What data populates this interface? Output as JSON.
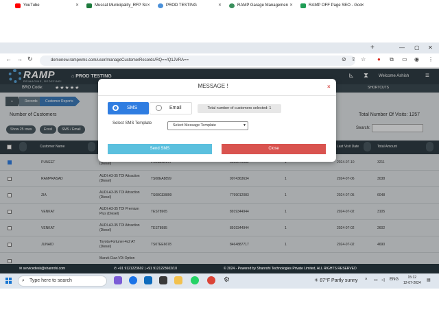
{
  "browser": {
    "tabs": [
      {
        "label": "YouTube",
        "color": "#ff0000"
      },
      {
        "label": "Muscat Municipality_RFP Sc",
        "color": "#1d7a3c"
      },
      {
        "label": "PROD TESTING",
        "color": "#4a90d9"
      },
      {
        "label": "RAMP Garage Managemen",
        "color": "#3a8f5c"
      },
      {
        "label": "RAMP OFF Page SEO - Goo",
        "color": "#1f9d55"
      }
    ],
    "url": "demonew.rampwms.com/user/manageCustomerRecords/RQ==/Q1JVRA=="
  },
  "app": {
    "logo": "RAMP",
    "logo_tagline": "REIMAGINE, REDEFINE!",
    "env_label": "PROD TESTING",
    "welcome": "Welcome  Ashish",
    "bro_code_label": "BRO Code:",
    "bro_stars": "★★★★★",
    "shortcuts_label": "SHORTCUTS"
  },
  "page": {
    "breadcrumbs": [
      "Records",
      "Customer Reports"
    ],
    "section_title": "Number of Customers",
    "total_visits": "Total Number Of Visits: 1257",
    "toolbar_buttons": [
      "Show 25 rows",
      "Excel",
      "SMS / Email"
    ],
    "search_label": "Search:",
    "columns": [
      "Customer Name",
      "Last Visit Date",
      "Total Amount"
    ],
    "rows": [
      {
        "checked": true,
        "name": "PUNEET",
        "vehicle": "(Diesel)",
        "reg": "PB08EA4237",
        "phone": "8968676082",
        "visits": "1",
        "date": "2024-07-10",
        "amount": "3211"
      },
      {
        "checked": false,
        "name": "RAMPRASAD",
        "vehicle": "AUDI-A3-35 TDI Attraction (Diesel)",
        "reg": "TS08EA8899",
        "phone": "9074363634",
        "visits": "1",
        "date": "2024-07-06",
        "amount": "3038"
      },
      {
        "checked": false,
        "name": "ZIA",
        "vehicle": "AUDI-A3-35 TDI Attraction (Diesel)",
        "reg": "TS08GE8899",
        "phone": "7799012083",
        "visits": "1",
        "date": "2024-07-05",
        "amount": "6048"
      },
      {
        "checked": false,
        "name": "VENKAT",
        "vehicle": "AUDI-A3-35 TDI Premium Plus (Diesel)",
        "reg": "TEST8965",
        "phone": "8919344944",
        "visits": "1",
        "date": "2024-07-02",
        "amount": "3105"
      },
      {
        "checked": false,
        "name": "VENKAT",
        "vehicle": "AUDI-A3-35 TDI Attraction (Diesel)",
        "reg": "TEST8985",
        "phone": "8919344944",
        "visits": "1",
        "date": "2024-07-02",
        "amount": "2602"
      },
      {
        "checked": false,
        "name": "JUNAID",
        "vehicle": "Toyota-Fortuner-4x2 AT (Diesel)",
        "reg": "TS07EE6678",
        "phone": "8464887717",
        "visits": "1",
        "date": "2024-07-02",
        "amount": "4690"
      },
      {
        "checked": false,
        "name": "",
        "vehicle": "Maruti-Ciaz-VDi Option",
        "reg": "",
        "phone": "",
        "visits": "",
        "date": "",
        "amount": ""
      }
    ]
  },
  "footer": {
    "email": "servicedesk@shanrohi.com",
    "phones": "+91 9121223602  |  +91 9121223602/10",
    "copyright": "© 2024 - Powered by Shanrohi Technologies Private Limited, ALL RIGHTS RESERVED"
  },
  "taskbar": {
    "search_placeholder": "Type here to search",
    "weather": "87°F  Partly sunny",
    "lang": "ENG",
    "time": "15:12",
    "date": "12-07-2024"
  },
  "modal": {
    "title": "MESSAGE !",
    "close_glyph": "×",
    "options": {
      "sms": "SMS",
      "email": "Email"
    },
    "selected_option": "sms",
    "total_selected": "Total number of customers selected: 1",
    "template_label": "Select SMS Template",
    "template_placeholder": "Select Message Template",
    "send_label": "Send SMS",
    "close_label": "Close"
  },
  "colors": {
    "header_dark": "#2f3d44",
    "primary_blue": "#2f7de1",
    "send_button": "#5bc0de",
    "close_button": "#d9534f"
  }
}
